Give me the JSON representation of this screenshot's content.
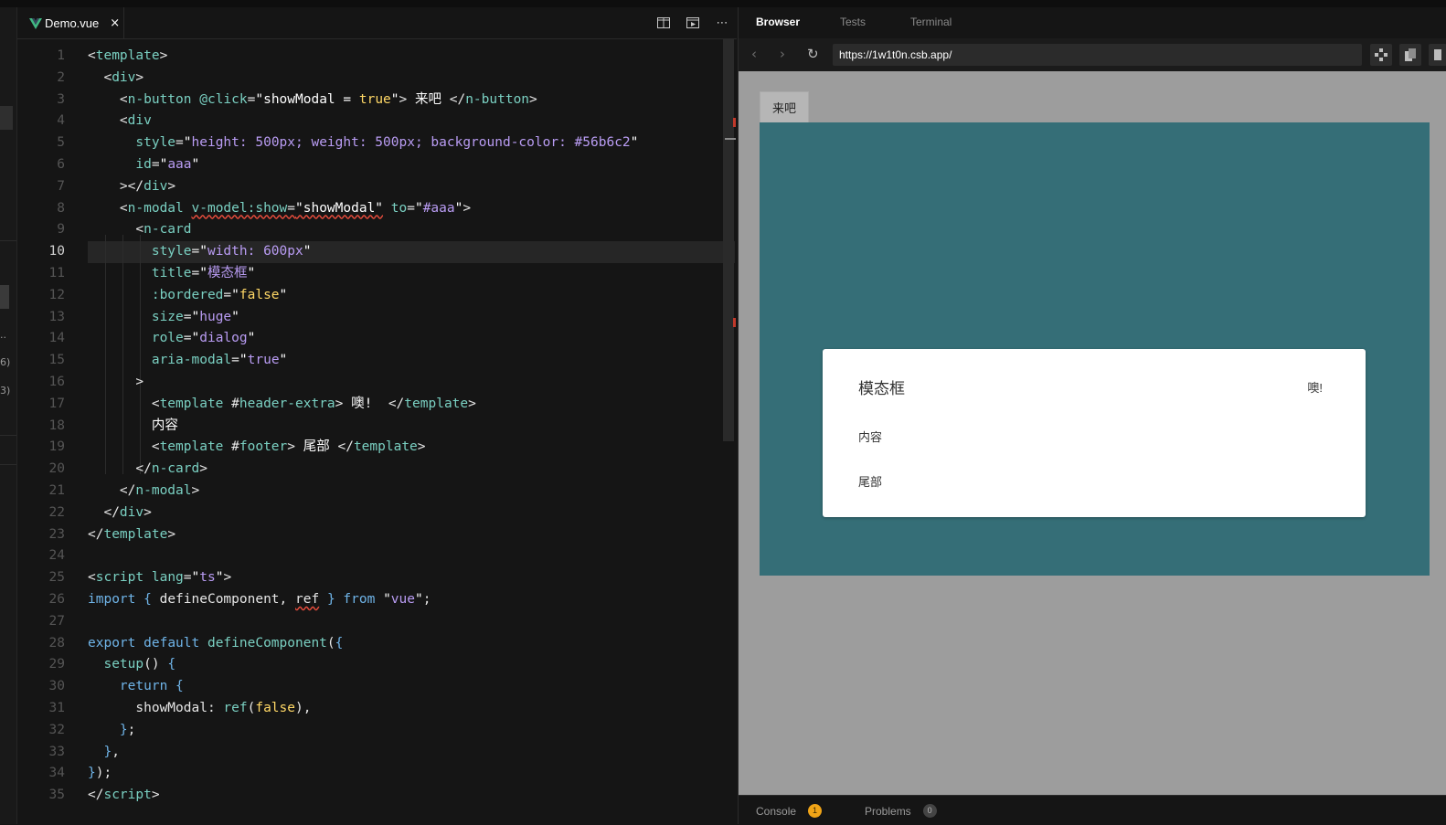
{
  "editor": {
    "tab": {
      "icon": "vue-logo-icon",
      "filename": "Demo.vue",
      "close": "×"
    },
    "toolbar": {
      "split": "split-editor-icon",
      "preview": "open-preview-icon",
      "more": "⋯"
    },
    "current_line": 10,
    "lines": [
      [
        [
          "t-tag",
          "<"
        ],
        [
          "t-name",
          "template"
        ],
        [
          "t-tag",
          ">"
        ]
      ],
      [
        [
          "t-tag",
          "  <"
        ],
        [
          "t-name",
          "div"
        ],
        [
          "t-tag",
          ">"
        ]
      ],
      [
        [
          "t-tag",
          "    <"
        ],
        [
          "t-name",
          "n-button"
        ],
        [
          "t-tag",
          " "
        ],
        [
          "t-attr",
          "@click"
        ],
        [
          "t-tag",
          "="
        ],
        [
          "t-str",
          "\"showModal = "
        ],
        [
          "t-kw",
          "true"
        ],
        [
          "t-str",
          "\""
        ],
        [
          "t-tag",
          "> "
        ],
        [
          "t-txt",
          "来吧"
        ],
        [
          "t-tag",
          " </"
        ],
        [
          "t-name",
          "n-button"
        ],
        [
          "t-tag",
          ">"
        ]
      ],
      [
        [
          "t-tag",
          "    <"
        ],
        [
          "t-name",
          "div"
        ]
      ],
      [
        [
          "t-tag",
          "      "
        ],
        [
          "t-attr",
          "style"
        ],
        [
          "t-tag",
          "="
        ],
        [
          "t-str",
          "\""
        ],
        [
          "t-sval",
          "height: 500px; weight: 500px; background-color: #56b6c2"
        ],
        [
          "t-str",
          "\""
        ]
      ],
      [
        [
          "t-tag",
          "      "
        ],
        [
          "t-attr",
          "id"
        ],
        [
          "t-tag",
          "="
        ],
        [
          "t-str",
          "\""
        ],
        [
          "t-sval",
          "aaa"
        ],
        [
          "t-str",
          "\""
        ]
      ],
      [
        [
          "t-tag",
          "    ></"
        ],
        [
          "t-name",
          "div"
        ],
        [
          "t-tag",
          ">"
        ]
      ],
      [
        [
          "t-tag",
          "    <"
        ],
        [
          "t-name",
          "n-modal"
        ],
        [
          "t-tag",
          " "
        ],
        [
          "t-attr squig",
          "v-model:show"
        ],
        [
          "t-tag squig",
          "="
        ],
        [
          "t-str squig",
          "\"showModal\""
        ],
        [
          "t-tag",
          " "
        ],
        [
          "t-attr",
          "to"
        ],
        [
          "t-tag",
          "="
        ],
        [
          "t-str",
          "\""
        ],
        [
          "t-sval",
          "#aaa"
        ],
        [
          "t-str",
          "\""
        ],
        [
          "t-tag",
          ">"
        ]
      ],
      [
        [
          "t-tag",
          "      <"
        ],
        [
          "t-name",
          "n-card"
        ]
      ],
      [
        [
          "t-tag",
          "        "
        ],
        [
          "t-attr",
          "style"
        ],
        [
          "t-tag",
          "="
        ],
        [
          "t-str",
          "\""
        ],
        [
          "t-sval",
          "width: 600px"
        ],
        [
          "t-str",
          "\""
        ]
      ],
      [
        [
          "t-tag",
          "        "
        ],
        [
          "t-attr",
          "title"
        ],
        [
          "t-tag",
          "="
        ],
        [
          "t-str",
          "\""
        ],
        [
          "t-sval",
          "模态框"
        ],
        [
          "t-str",
          "\""
        ]
      ],
      [
        [
          "t-tag",
          "        "
        ],
        [
          "t-attr",
          ":bordered"
        ],
        [
          "t-tag",
          "="
        ],
        [
          "t-str",
          "\""
        ],
        [
          "t-kw",
          "false"
        ],
        [
          "t-str",
          "\""
        ]
      ],
      [
        [
          "t-tag",
          "        "
        ],
        [
          "t-attr",
          "size"
        ],
        [
          "t-tag",
          "="
        ],
        [
          "t-str",
          "\""
        ],
        [
          "t-sval",
          "huge"
        ],
        [
          "t-str",
          "\""
        ]
      ],
      [
        [
          "t-tag",
          "        "
        ],
        [
          "t-attr",
          "role"
        ],
        [
          "t-tag",
          "="
        ],
        [
          "t-str",
          "\""
        ],
        [
          "t-sval",
          "dialog"
        ],
        [
          "t-str",
          "\""
        ]
      ],
      [
        [
          "t-tag",
          "        "
        ],
        [
          "t-attr",
          "aria-modal"
        ],
        [
          "t-tag",
          "="
        ],
        [
          "t-str",
          "\""
        ],
        [
          "t-sval",
          "true"
        ],
        [
          "t-str",
          "\""
        ]
      ],
      [
        [
          "t-tag",
          "      >"
        ]
      ],
      [
        [
          "t-tag",
          "        <"
        ],
        [
          "t-name",
          "template"
        ],
        [
          "t-tag",
          " #"
        ],
        [
          "t-attr",
          "header-extra"
        ],
        [
          "t-tag",
          "> "
        ],
        [
          "t-txt",
          "噢!  "
        ],
        [
          "t-tag",
          "</"
        ],
        [
          "t-name",
          "template"
        ],
        [
          "t-tag",
          ">"
        ]
      ],
      [
        [
          "t-txt",
          "        内容"
        ]
      ],
      [
        [
          "t-tag",
          "        <"
        ],
        [
          "t-name",
          "template"
        ],
        [
          "t-tag",
          " #"
        ],
        [
          "t-attr",
          "footer"
        ],
        [
          "t-tag",
          "> "
        ],
        [
          "t-txt",
          "尾部"
        ],
        [
          "t-tag",
          " </"
        ],
        [
          "t-name",
          "template"
        ],
        [
          "t-tag",
          ">"
        ]
      ],
      [
        [
          "t-tag",
          "      </"
        ],
        [
          "t-name",
          "n-card"
        ],
        [
          "t-tag",
          ">"
        ]
      ],
      [
        [
          "t-tag",
          "    </"
        ],
        [
          "t-name",
          "n-modal"
        ],
        [
          "t-tag",
          ">"
        ]
      ],
      [
        [
          "t-tag",
          "  </"
        ],
        [
          "t-name",
          "div"
        ],
        [
          "t-tag",
          ">"
        ]
      ],
      [
        [
          "t-tag",
          "</"
        ],
        [
          "t-name",
          "template"
        ],
        [
          "t-tag",
          ">"
        ]
      ],
      [],
      [
        [
          "t-tag",
          "<"
        ],
        [
          "t-name",
          "script"
        ],
        [
          "t-tag",
          " "
        ],
        [
          "t-attr",
          "lang"
        ],
        [
          "t-tag",
          "="
        ],
        [
          "t-str",
          "\""
        ],
        [
          "t-sval",
          "ts"
        ],
        [
          "t-str",
          "\""
        ],
        [
          "t-tag",
          ">"
        ]
      ],
      [
        [
          "t-blue",
          "import"
        ],
        [
          "t-tag",
          " "
        ],
        [
          "t-blue",
          "{"
        ],
        [
          "t-tag",
          " defineComponent, "
        ],
        [
          "t-tag squig",
          "ref"
        ],
        [
          "t-tag",
          " "
        ],
        [
          "t-blue",
          "}"
        ],
        [
          "t-tag",
          " "
        ],
        [
          "t-blue",
          "from"
        ],
        [
          "t-tag",
          " "
        ],
        [
          "t-str",
          "\""
        ],
        [
          "t-sval",
          "vue"
        ],
        [
          "t-str",
          "\""
        ],
        [
          "t-tag",
          ";"
        ]
      ],
      [],
      [
        [
          "t-blue",
          "export"
        ],
        [
          "t-tag",
          " "
        ],
        [
          "t-blue",
          "default"
        ],
        [
          "t-tag",
          " "
        ],
        [
          "t-fn",
          "defineComponent"
        ],
        [
          "t-tag",
          "("
        ],
        [
          "t-blue",
          "{"
        ]
      ],
      [
        [
          "t-tag",
          "  "
        ],
        [
          "t-fn",
          "setup"
        ],
        [
          "t-tag",
          "() "
        ],
        [
          "t-blue",
          "{"
        ]
      ],
      [
        [
          "t-tag",
          "    "
        ],
        [
          "t-blue",
          "return"
        ],
        [
          "t-tag",
          " "
        ],
        [
          "t-blue",
          "{"
        ]
      ],
      [
        [
          "t-tag",
          "      showModal: "
        ],
        [
          "t-fn",
          "ref"
        ],
        [
          "t-tag",
          "("
        ],
        [
          "t-kw",
          "false"
        ],
        [
          "t-tag",
          "),"
        ]
      ],
      [
        [
          "t-tag",
          "    "
        ],
        [
          "t-blue",
          "}"
        ],
        [
          "t-tag",
          ";"
        ]
      ],
      [
        [
          "t-tag",
          "  "
        ],
        [
          "t-blue",
          "}"
        ],
        [
          "t-tag",
          ","
        ]
      ],
      [
        [
          "t-blue",
          "}"
        ],
        [
          "t-tag",
          ");"
        ]
      ],
      [
        [
          "t-tag",
          "</"
        ],
        [
          "t-name",
          "script"
        ],
        [
          "t-tag",
          ">"
        ]
      ]
    ]
  },
  "leftstrip": {
    "text_a": "..",
    "text_b": "6)",
    "text_c": "3)"
  },
  "panel": {
    "tabs": [
      "Browser",
      "Tests",
      "Terminal"
    ],
    "active_tab": "Browser",
    "url": "https://1w1t0n.csb.app/",
    "nav": {
      "back": "‹",
      "forward": "›",
      "reload": "↻"
    },
    "app": {
      "button_label": "来吧",
      "modal_bg_color": "#356e77",
      "card": {
        "title": "模态框",
        "header_extra": "噢!",
        "content": "内容",
        "footer": "尾部"
      }
    },
    "bottom": {
      "console": {
        "label": "Console",
        "count": "1"
      },
      "problems": {
        "label": "Problems",
        "count": "0"
      }
    }
  }
}
